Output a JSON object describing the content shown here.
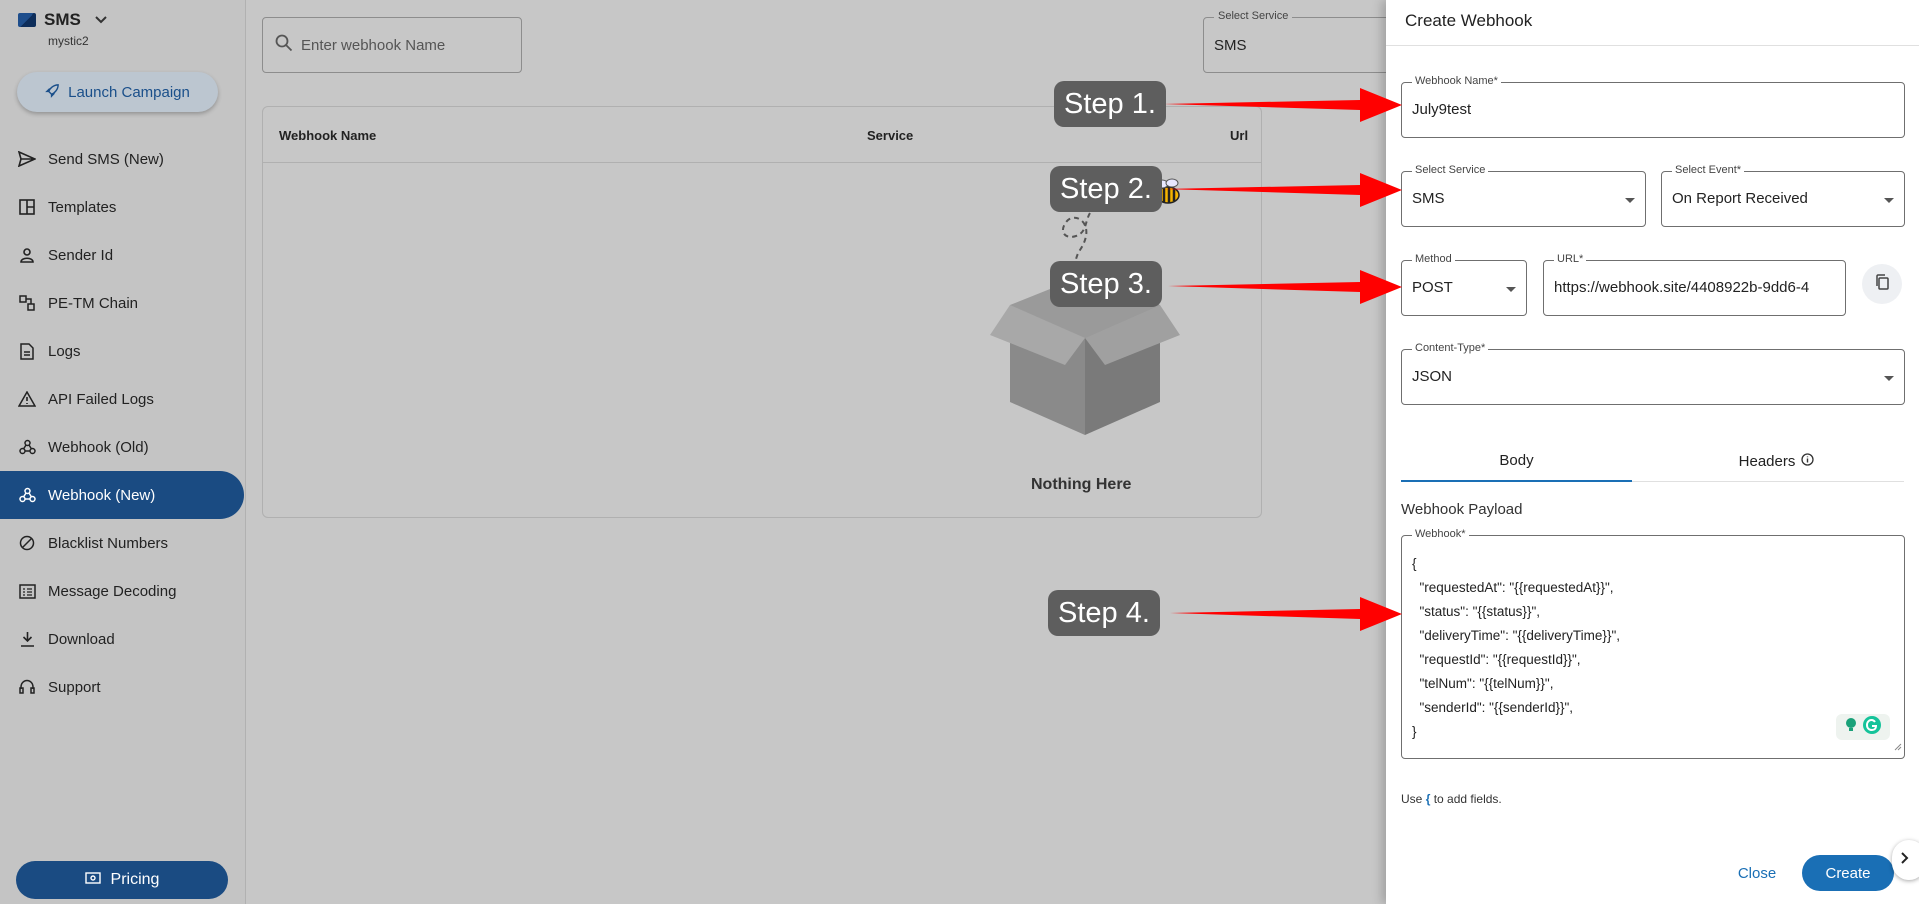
{
  "sidebar": {
    "brand": "SMS",
    "account": "mystic2",
    "launch_label": "Launch Campaign",
    "items": [
      {
        "label": "Send SMS (New)",
        "icon": "send-icon"
      },
      {
        "label": "Templates",
        "icon": "template-icon"
      },
      {
        "label": "Sender Id",
        "icon": "person-icon"
      },
      {
        "label": "PE-TM Chain",
        "icon": "chain-icon"
      },
      {
        "label": "Logs",
        "icon": "document-icon"
      },
      {
        "label": "API Failed Logs",
        "icon": "warning-icon"
      },
      {
        "label": "Webhook (Old)",
        "icon": "webhook-icon"
      },
      {
        "label": "Webhook (New)",
        "icon": "webhook-icon"
      },
      {
        "label": "Blacklist Numbers",
        "icon": "block-icon"
      },
      {
        "label": "Message Decoding",
        "icon": "list-icon"
      },
      {
        "label": "Download",
        "icon": "download-icon"
      },
      {
        "label": "Support",
        "icon": "headset-icon"
      }
    ],
    "active_item": "Webhook (New)",
    "pricing_label": "Pricing"
  },
  "main": {
    "search_placeholder": "Enter webhook Name",
    "service_filter": {
      "label": "Select Service",
      "value": "SMS"
    },
    "table": {
      "columns": [
        "Webhook Name",
        "Service",
        "Url"
      ]
    },
    "empty_text": "Nothing Here"
  },
  "steps": [
    "Step 1.",
    "Step 2.",
    "Step 3.",
    "Step 4."
  ],
  "drawer": {
    "title": "Create Webhook",
    "webhook_name": {
      "label": "Webhook Name*",
      "value": "July9test"
    },
    "service": {
      "label": "Select Service",
      "value": "SMS"
    },
    "event": {
      "label": "Select Event*",
      "value": "On Report Received"
    },
    "method": {
      "label": "Method",
      "value": "POST"
    },
    "url": {
      "label": "URL*",
      "value": "https://webhook.site/4408922b-9dd6-4"
    },
    "content_type": {
      "label": "Content-Type*",
      "value": "JSON"
    },
    "tabs": [
      "Body",
      "Headers"
    ],
    "active_tab": "Body",
    "payload_title": "Webhook Payload",
    "payload": {
      "label": "Webhook*",
      "value": "{\n  \"requestedAt\": \"{{requestedAt}}\",\n  \"status\": \"{{status}}\",\n  \"deliveryTime\": \"{{deliveryTime}}\",\n  \"requestId\": \"{{requestId}}\",\n  \"telNum\": \"{{telNum}}\",\n  \"senderId\": \"{{senderId}}\",\n}"
    },
    "hint_prefix": "Use",
    "hint_brace": "{",
    "hint_suffix": "to add fields.",
    "close_label": "Close",
    "create_label": "Create"
  },
  "colors": {
    "accent": "#1a6fb5",
    "active_nav": "#1a4b82",
    "arrow": "#ff0000",
    "step_bg": "#5e5e5e"
  }
}
